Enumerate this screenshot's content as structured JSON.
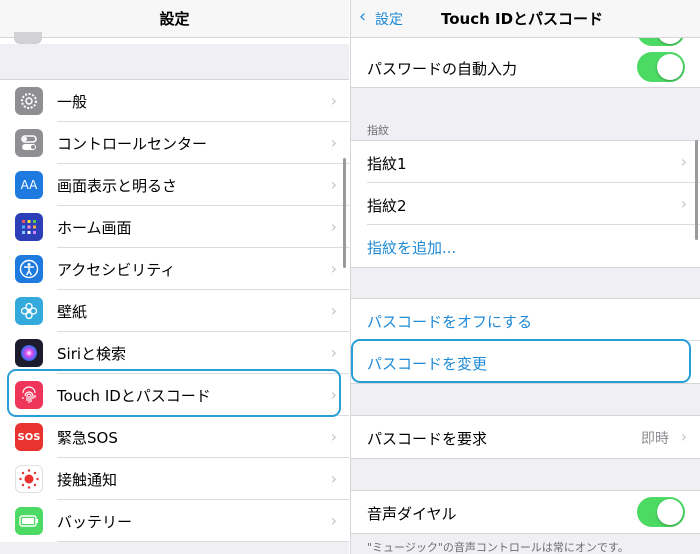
{
  "left": {
    "title": "設定",
    "items": [
      {
        "label": "一般",
        "icon": "gear-icon",
        "color": "#8e8e93"
      },
      {
        "label": "コントロールセンター",
        "icon": "switches-icon",
        "color": "#8e8e93"
      },
      {
        "label": "画面表示と明るさ",
        "icon": "text-size-icon",
        "color": "#1f7ae0",
        "glyph": "AA"
      },
      {
        "label": "ホーム画面",
        "icon": "home-grid-icon",
        "color": "#2c3fb8"
      },
      {
        "label": "アクセシビリティ",
        "icon": "accessibility-icon",
        "color": "#1f7ae0"
      },
      {
        "label": "壁紙",
        "icon": "flower-icon",
        "color": "#34aadc"
      },
      {
        "label": "Siriと検索",
        "icon": "siri-icon",
        "color": "#222"
      },
      {
        "label": "Touch IDとパスコード",
        "icon": "fingerprint-icon",
        "color": "#f0355b"
      },
      {
        "label": "緊急SOS",
        "icon": "sos-icon",
        "color": "#e8332f",
        "glyph": "SOS"
      },
      {
        "label": "接触通知",
        "icon": "exposure-icon",
        "color": "#fff"
      },
      {
        "label": "バッテリー",
        "icon": "battery-icon",
        "color": "#4cd964"
      }
    ]
  },
  "right": {
    "back_label": "設定",
    "title": "Touch IDとパスコード",
    "autofill_label": "パスワードの自動入力",
    "fingerprint_header": "指紋",
    "fingerprints": [
      "指紋1",
      "指紋2"
    ],
    "add_fingerprint": "指紋を追加...",
    "turn_off": "パスコードをオフにする",
    "change": "パスコードを変更",
    "require_label": "パスコードを要求",
    "require_value": "即時",
    "voice_dial": "音声ダイヤル",
    "voice_note": "\"ミュージック\"の音声コントロールは常にオンです。"
  },
  "colors": {
    "accent": "#1f8ad6",
    "toggle_on": "#4cd964",
    "highlight": "#2a9fd6"
  }
}
